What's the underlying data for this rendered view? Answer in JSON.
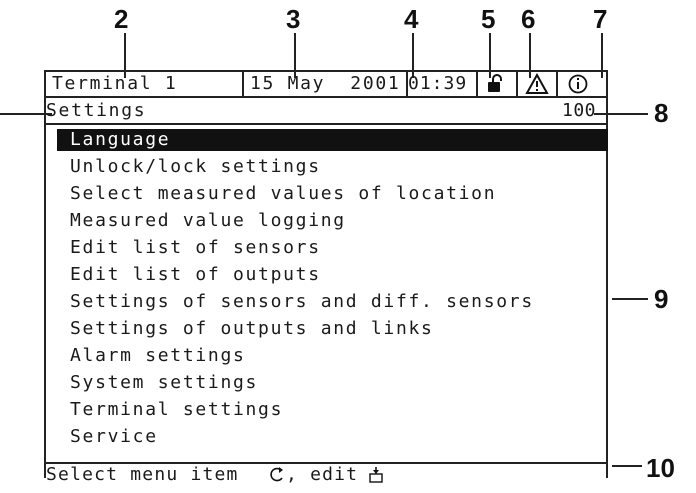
{
  "callouts": {
    "c2": "2",
    "c3": "3",
    "c4": "4",
    "c5": "5",
    "c6": "6",
    "c7": "7",
    "c8": "8",
    "c9": "9",
    "c10": "10"
  },
  "header": {
    "terminal": "Terminal 1",
    "date": "15 May  2001",
    "time": "01:39",
    "lock_icon": "lock-icon",
    "warning_icon": "warning-icon",
    "info_icon": "info-icon"
  },
  "title_bar": {
    "title": "Settings",
    "code": "100"
  },
  "menu": {
    "items": [
      {
        "label": "Language",
        "selected": true
      },
      {
        "label": "Unlock/lock settings"
      },
      {
        "label": "Select measured values of location"
      },
      {
        "label": "Measured value logging"
      },
      {
        "label": "Edit list of sensors"
      },
      {
        "label": "Edit list of outputs"
      },
      {
        "label": "Settings of sensors and diff. sensors"
      },
      {
        "label": "Settings of outputs and links"
      },
      {
        "label": "Alarm settings"
      },
      {
        "label": "System settings"
      },
      {
        "label": "Terminal settings"
      },
      {
        "label": "Service"
      }
    ]
  },
  "footer": {
    "hint_text": "Select menu item",
    "sep": ", edit",
    "turn_icon": "rotate-knob-icon",
    "press_icon": "press-knob-icon"
  }
}
